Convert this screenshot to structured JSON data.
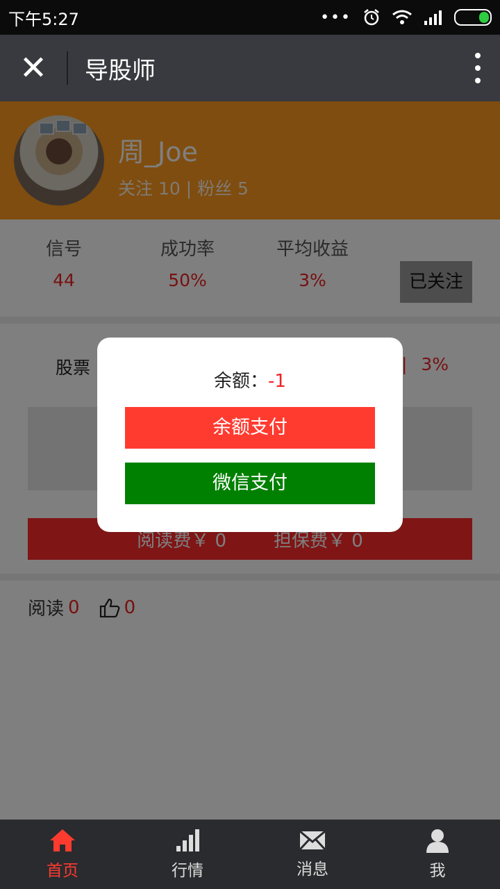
{
  "status": {
    "time": "下午5:27",
    "dots": "•••"
  },
  "header": {
    "title": "导股师",
    "close_glyph": "✕"
  },
  "profile": {
    "name": "周_Joe",
    "follow_text": "关注 10 | 粉丝 5"
  },
  "stats": [
    {
      "label": "信号",
      "value": "44"
    },
    {
      "label": "成功率",
      "value": "50%"
    },
    {
      "label": "平均收益",
      "value": "3%"
    }
  ],
  "followed_label": "已关注",
  "detail": {
    "stock_label": "股票",
    "right_value": "3%",
    "read_fee": "阅读费￥ 0",
    "guarantee_fee": "担保费￥ 0"
  },
  "reads": {
    "label": "阅读",
    "count": "0",
    "likes": "0"
  },
  "dialog": {
    "balance_label": "余额：",
    "balance_value": "-1",
    "balance_pay": "余额支付",
    "wechat_pay": "微信支付",
    "balance_pay_color": "#ff3b30",
    "wechat_pay_color": "#008000"
  },
  "tabs": [
    {
      "label": "首页",
      "icon": "home-icon",
      "active": true
    },
    {
      "label": "行情",
      "icon": "signal-bars-icon",
      "active": false
    },
    {
      "label": "消息",
      "icon": "mail-icon",
      "active": false
    },
    {
      "label": "我",
      "icon": "user-icon",
      "active": false
    }
  ]
}
